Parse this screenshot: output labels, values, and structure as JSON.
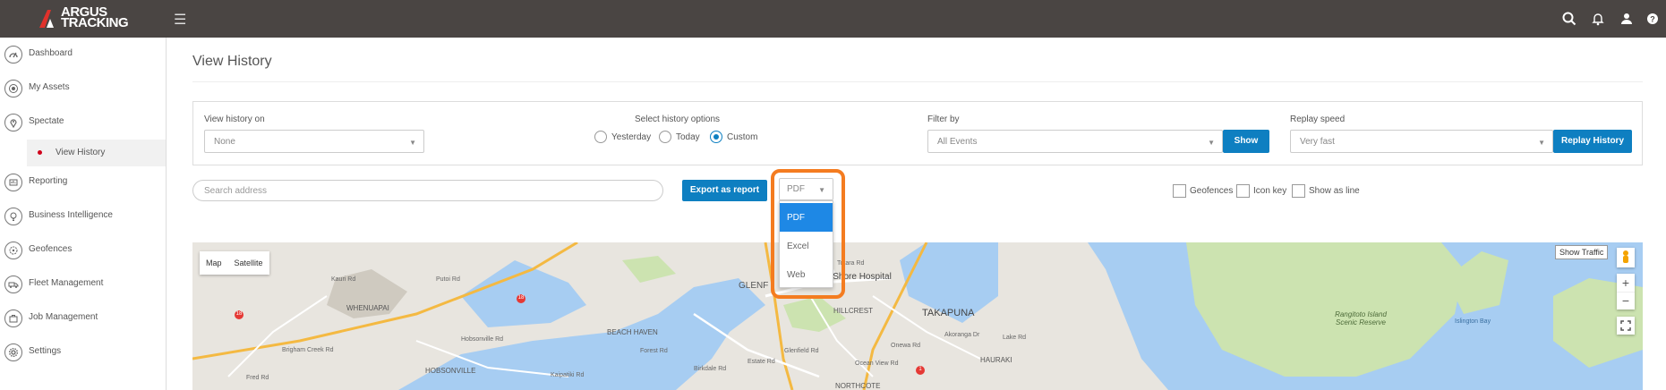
{
  "header": {
    "logo_line1": "ARGUS",
    "logo_line2": "TRACKING"
  },
  "sidebar": {
    "items": [
      {
        "label": "Dashboard"
      },
      {
        "label": "My Assets"
      },
      {
        "label": "Spectate"
      },
      {
        "label": "Reporting"
      },
      {
        "label": "Business Intelligence"
      },
      {
        "label": "Geofences"
      },
      {
        "label": "Fleet Management"
      },
      {
        "label": "Job Management"
      },
      {
        "label": "Settings"
      }
    ],
    "sub_item": "View History"
  },
  "page": {
    "title": "View History"
  },
  "filters": {
    "view_history_label": "View history on",
    "view_history_value": "None",
    "history_options_label": "Select history options",
    "options": [
      "Yesterday",
      "Today",
      "Custom"
    ],
    "selected_option": "Custom",
    "filter_by_label": "Filter by",
    "filter_by_value": "All Events",
    "show_button": "Show",
    "replay_speed_label": "Replay speed",
    "replay_speed_value": "Very fast",
    "replay_button": "Replay History"
  },
  "toolbar": {
    "search_placeholder": "Search address",
    "export_button": "Export as report",
    "format_value": "PDF",
    "format_options": [
      "PDF",
      "Excel",
      "Web"
    ],
    "geofences_label": "Geofences",
    "icon_key_label": "Icon key",
    "show_as_line_label": "Show as line"
  },
  "map": {
    "map_tab": "Map",
    "satellite_tab": "Satellite",
    "show_traffic": "Show Traffic",
    "places": [
      "WHENUAPAI",
      "HOBSONVILLE",
      "BEACH HAVEN",
      "GLENF",
      "North Shore Hospital",
      "HILLCREST",
      "TAKAPUNA",
      "HAURAKI",
      "NORTHCOTE",
      "Rangitoto Island Scenic Reserve"
    ],
    "roads": [
      "Brigham Creek Rd",
      "Kauri Rd",
      "Putoi Rd",
      "Glenfield Rd",
      "Onewa Rd",
      "Lake Rd",
      "Estate Rd",
      "Ocean View Rd",
      "Islington Bay",
      "Totara Rd",
      "Fred Rd",
      "Hobsonville Rd",
      "Birkdale Rd",
      "Forest Rd",
      "Kaipatiki Rd",
      "Akoranga Dr"
    ],
    "route_numbers": [
      "18",
      "18",
      "1"
    ],
    "zoom_in": "+",
    "zoom_out": "−"
  },
  "colors": {
    "topbar": "#4a4543",
    "accent": "#0e7fc1",
    "highlight": "#f47c20",
    "water": "#a7cdf2",
    "park": "#cce3b0"
  }
}
